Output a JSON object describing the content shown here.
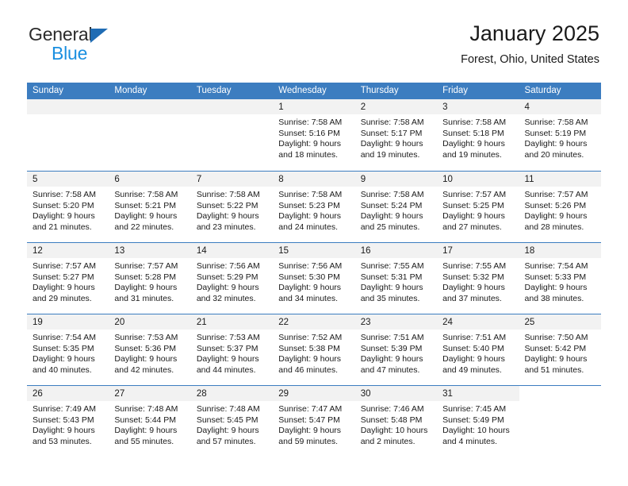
{
  "brand": {
    "name_top": "General",
    "name_bottom": "Blue",
    "triangle_color": "#1f6cb4",
    "blue_text_color": "#1a8fe0"
  },
  "header": {
    "title": "January 2025",
    "subtitle": "Forest, Ohio, United States"
  },
  "colors": {
    "header_row_bg": "#3c7dc0",
    "header_row_text": "#ffffff",
    "daynum_bar_bg": "#f2f2f2",
    "grid_line": "#3c7dc0",
    "body_text": "#1a1a1a"
  },
  "weekday_headers": [
    "Sunday",
    "Monday",
    "Tuesday",
    "Wednesday",
    "Thursday",
    "Friday",
    "Saturday"
  ],
  "weeks": [
    [
      {
        "day": "",
        "blank": true,
        "lines": []
      },
      {
        "day": "",
        "blank": true,
        "lines": []
      },
      {
        "day": "",
        "blank": true,
        "lines": []
      },
      {
        "day": "1",
        "lines": [
          "Sunrise: 7:58 AM",
          "Sunset: 5:16 PM",
          "Daylight: 9 hours",
          "and 18 minutes."
        ]
      },
      {
        "day": "2",
        "lines": [
          "Sunrise: 7:58 AM",
          "Sunset: 5:17 PM",
          "Daylight: 9 hours",
          "and 19 minutes."
        ]
      },
      {
        "day": "3",
        "lines": [
          "Sunrise: 7:58 AM",
          "Sunset: 5:18 PM",
          "Daylight: 9 hours",
          "and 19 minutes."
        ]
      },
      {
        "day": "4",
        "lines": [
          "Sunrise: 7:58 AM",
          "Sunset: 5:19 PM",
          "Daylight: 9 hours",
          "and 20 minutes."
        ]
      }
    ],
    [
      {
        "day": "5",
        "lines": [
          "Sunrise: 7:58 AM",
          "Sunset: 5:20 PM",
          "Daylight: 9 hours",
          "and 21 minutes."
        ]
      },
      {
        "day": "6",
        "lines": [
          "Sunrise: 7:58 AM",
          "Sunset: 5:21 PM",
          "Daylight: 9 hours",
          "and 22 minutes."
        ]
      },
      {
        "day": "7",
        "lines": [
          "Sunrise: 7:58 AM",
          "Sunset: 5:22 PM",
          "Daylight: 9 hours",
          "and 23 minutes."
        ]
      },
      {
        "day": "8",
        "lines": [
          "Sunrise: 7:58 AM",
          "Sunset: 5:23 PM",
          "Daylight: 9 hours",
          "and 24 minutes."
        ]
      },
      {
        "day": "9",
        "lines": [
          "Sunrise: 7:58 AM",
          "Sunset: 5:24 PM",
          "Daylight: 9 hours",
          "and 25 minutes."
        ]
      },
      {
        "day": "10",
        "lines": [
          "Sunrise: 7:57 AM",
          "Sunset: 5:25 PM",
          "Daylight: 9 hours",
          "and 27 minutes."
        ]
      },
      {
        "day": "11",
        "lines": [
          "Sunrise: 7:57 AM",
          "Sunset: 5:26 PM",
          "Daylight: 9 hours",
          "and 28 minutes."
        ]
      }
    ],
    [
      {
        "day": "12",
        "lines": [
          "Sunrise: 7:57 AM",
          "Sunset: 5:27 PM",
          "Daylight: 9 hours",
          "and 29 minutes."
        ]
      },
      {
        "day": "13",
        "lines": [
          "Sunrise: 7:57 AM",
          "Sunset: 5:28 PM",
          "Daylight: 9 hours",
          "and 31 minutes."
        ]
      },
      {
        "day": "14",
        "lines": [
          "Sunrise: 7:56 AM",
          "Sunset: 5:29 PM",
          "Daylight: 9 hours",
          "and 32 minutes."
        ]
      },
      {
        "day": "15",
        "lines": [
          "Sunrise: 7:56 AM",
          "Sunset: 5:30 PM",
          "Daylight: 9 hours",
          "and 34 minutes."
        ]
      },
      {
        "day": "16",
        "lines": [
          "Sunrise: 7:55 AM",
          "Sunset: 5:31 PM",
          "Daylight: 9 hours",
          "and 35 minutes."
        ]
      },
      {
        "day": "17",
        "lines": [
          "Sunrise: 7:55 AM",
          "Sunset: 5:32 PM",
          "Daylight: 9 hours",
          "and 37 minutes."
        ]
      },
      {
        "day": "18",
        "lines": [
          "Sunrise: 7:54 AM",
          "Sunset: 5:33 PM",
          "Daylight: 9 hours",
          "and 38 minutes."
        ]
      }
    ],
    [
      {
        "day": "19",
        "lines": [
          "Sunrise: 7:54 AM",
          "Sunset: 5:35 PM",
          "Daylight: 9 hours",
          "and 40 minutes."
        ]
      },
      {
        "day": "20",
        "lines": [
          "Sunrise: 7:53 AM",
          "Sunset: 5:36 PM",
          "Daylight: 9 hours",
          "and 42 minutes."
        ]
      },
      {
        "day": "21",
        "lines": [
          "Sunrise: 7:53 AM",
          "Sunset: 5:37 PM",
          "Daylight: 9 hours",
          "and 44 minutes."
        ]
      },
      {
        "day": "22",
        "lines": [
          "Sunrise: 7:52 AM",
          "Sunset: 5:38 PM",
          "Daylight: 9 hours",
          "and 46 minutes."
        ]
      },
      {
        "day": "23",
        "lines": [
          "Sunrise: 7:51 AM",
          "Sunset: 5:39 PM",
          "Daylight: 9 hours",
          "and 47 minutes."
        ]
      },
      {
        "day": "24",
        "lines": [
          "Sunrise: 7:51 AM",
          "Sunset: 5:40 PM",
          "Daylight: 9 hours",
          "and 49 minutes."
        ]
      },
      {
        "day": "25",
        "lines": [
          "Sunrise: 7:50 AM",
          "Sunset: 5:42 PM",
          "Daylight: 9 hours",
          "and 51 minutes."
        ]
      }
    ],
    [
      {
        "day": "26",
        "lines": [
          "Sunrise: 7:49 AM",
          "Sunset: 5:43 PM",
          "Daylight: 9 hours",
          "and 53 minutes."
        ]
      },
      {
        "day": "27",
        "lines": [
          "Sunrise: 7:48 AM",
          "Sunset: 5:44 PM",
          "Daylight: 9 hours",
          "and 55 minutes."
        ]
      },
      {
        "day": "28",
        "lines": [
          "Sunrise: 7:48 AM",
          "Sunset: 5:45 PM",
          "Daylight: 9 hours",
          "and 57 minutes."
        ]
      },
      {
        "day": "29",
        "lines": [
          "Sunrise: 7:47 AM",
          "Sunset: 5:47 PM",
          "Daylight: 9 hours",
          "and 59 minutes."
        ]
      },
      {
        "day": "30",
        "lines": [
          "Sunrise: 7:46 AM",
          "Sunset: 5:48 PM",
          "Daylight: 10 hours",
          "and 2 minutes."
        ]
      },
      {
        "day": "31",
        "lines": [
          "Sunrise: 7:45 AM",
          "Sunset: 5:49 PM",
          "Daylight: 10 hours",
          "and 4 minutes."
        ]
      },
      {
        "day": "",
        "empty": true,
        "lines": []
      }
    ]
  ]
}
